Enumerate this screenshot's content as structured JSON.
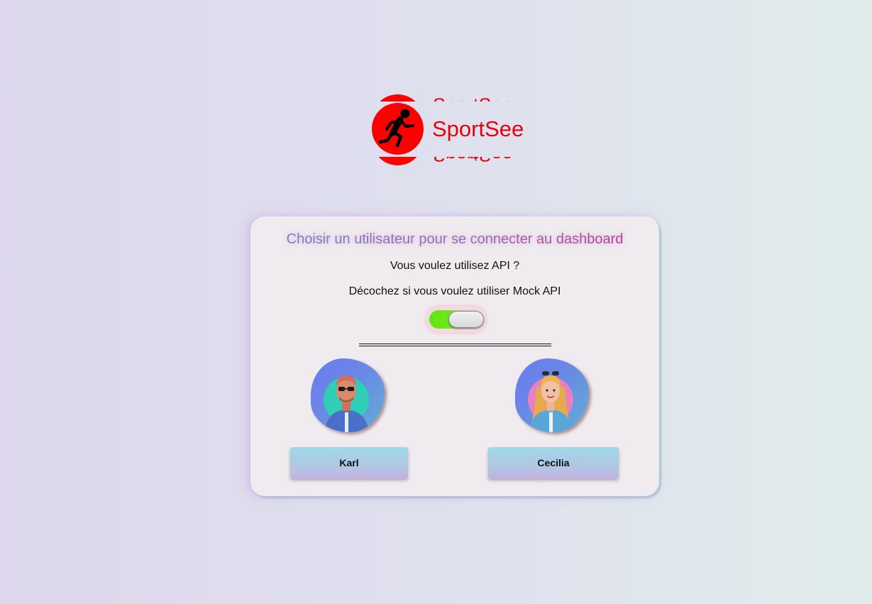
{
  "brand": {
    "name": "SportSee",
    "logo_color": "#e8000b",
    "icon": "runner-icon"
  },
  "login_card": {
    "title": "Choisir un utilisateur pour se connecter au dashboard",
    "api_question": "Vous voulez utilisez API ?",
    "mock_hint": "Décochez si vous voulez utiliser Mock API",
    "api_toggle": {
      "checked": true,
      "on_color": "#5ee60d"
    }
  },
  "users": [
    {
      "name": "Karl",
      "avatar": "man-avatar-icon"
    },
    {
      "name": "Cecilia",
      "avatar": "woman-avatar-icon"
    }
  ]
}
